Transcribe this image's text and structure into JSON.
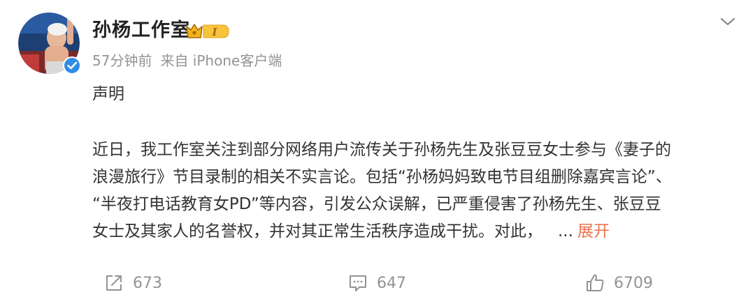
{
  "user": {
    "name": "孙杨工作室",
    "vip_level": "I"
  },
  "meta": {
    "time": "57分钟前",
    "source": "来自 iPhone客户端"
  },
  "post": {
    "title": "声明",
    "lines": [
      "近日，我工作室关注到部分网络用户流传关于孙杨先生及张豆豆女士参与《妻子的",
      "浪漫旅行》节目录制的相关不实言论。包括“孙杨妈妈致电节目组删除嘉宾言论”、",
      "“半夜打电话教育女PD”等内容，引发公众误解，已严重侵害了孙杨先生、张豆豆",
      "女士及其家人的名誉权，并对其正常生活秩序造成干扰。对此，"
    ],
    "ellipsis": "...",
    "expand_label": "展开"
  },
  "actions": {
    "share_count": "673",
    "comment_count": "647",
    "like_count": "6709"
  },
  "colors": {
    "accent": "#eb7350",
    "meta_gray": "#939393",
    "verified_blue": "#2f8ce6",
    "vip_gold": "#f5b31a"
  },
  "icons": {
    "verified": "verified-icon",
    "vip": "vip-crown-icon",
    "more": "chevron-down-icon",
    "share": "share-icon",
    "comment": "comment-icon",
    "like": "thumbs-up-icon"
  }
}
